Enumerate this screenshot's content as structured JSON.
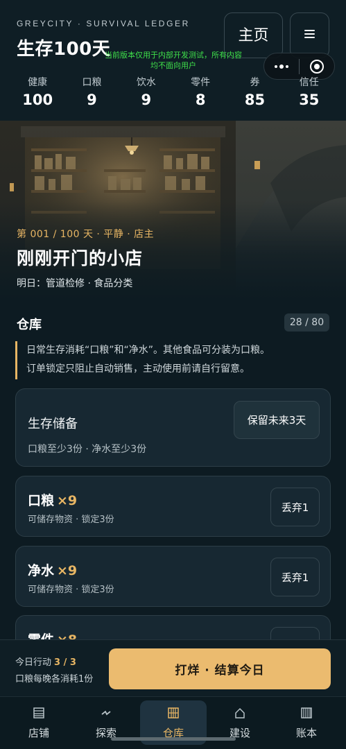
{
  "header": {
    "brand": "GREYCITY · SURVIVAL LEDGER",
    "title": "生存100天",
    "home_label": "主页",
    "menu_icon": "hamburger-icon",
    "dev_notice": "当前版本仅用于内部开发测试，所有内容均不面向用户",
    "stats": [
      {
        "label": "健康",
        "value": "100"
      },
      {
        "label": "口粮",
        "value": "9"
      },
      {
        "label": "饮水",
        "value": "9"
      },
      {
        "label": "零件",
        "value": "8"
      },
      {
        "label": "券",
        "value": "85"
      },
      {
        "label": "信任",
        "value": "35"
      }
    ]
  },
  "hero": {
    "day_line": "第 001 / 100 天 · 平静 · 店主",
    "shop_title": "刚刚开门的小店",
    "tomorrow": "明日：管道检修 · 食品分类"
  },
  "warehouse": {
    "title": "仓库",
    "capacity": "28 / 80",
    "hint_lines": [
      "日常生存消耗“口粮”和“净水”。其他食品可分装为口粮。",
      "订单锁定只阻止自动销售，主动使用前请自行留意。"
    ],
    "reserve": {
      "title": "生存储备",
      "subtitle": "口粮至少3份 · 净水至少3份",
      "button": "保留未来3天"
    },
    "items": [
      {
        "name": "口粮",
        "count": "×9",
        "subtitle": "可储存物资 · 锁定3份",
        "button": "丢弃1"
      },
      {
        "name": "净水",
        "count": "×9",
        "subtitle": "可储存物资 · 锁定3份",
        "button": "丢弃1"
      },
      {
        "name": "零件",
        "count": "×8"
      }
    ]
  },
  "action_bar": {
    "action_label": "今日行动",
    "action_value": "3 / 3",
    "note": "口粮每晚各消耗1份",
    "settle_button": "打烊 · 结算今日"
  },
  "tabs": [
    {
      "label": "店铺",
      "icon": "shop-icon"
    },
    {
      "label": "探索",
      "icon": "explore-icon"
    },
    {
      "label": "仓库",
      "icon": "warehouse-icon",
      "active": true
    },
    {
      "label": "建设",
      "icon": "build-icon"
    },
    {
      "label": "账本",
      "icon": "ledger-icon"
    }
  ],
  "colors": {
    "background": "#0d1b22",
    "accent": "#e8b664",
    "card": "#172832",
    "dev_notice": "#3fe04a"
  }
}
